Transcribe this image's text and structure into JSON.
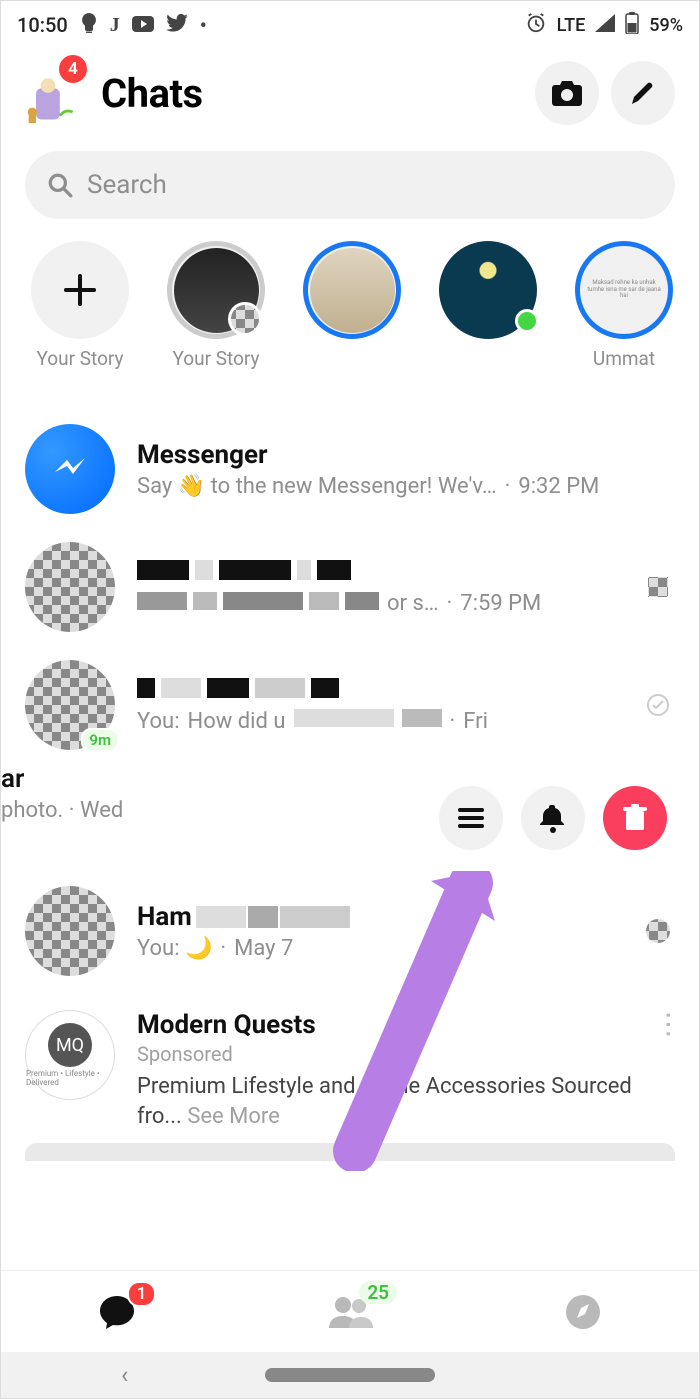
{
  "status": {
    "time": "10:50",
    "network": "LTE",
    "battery": "59%"
  },
  "header": {
    "title": "Chats",
    "badge": "4"
  },
  "search": {
    "placeholder": "Search"
  },
  "stories": [
    {
      "label": "Your Story",
      "type": "add"
    },
    {
      "label": "Your Story",
      "type": "viewed"
    },
    {
      "label": "",
      "type": "unseen"
    },
    {
      "label": "",
      "type": "online"
    },
    {
      "label": "Ummat",
      "type": "unseen"
    }
  ],
  "chats": {
    "messenger": {
      "name": "Messenger",
      "msg": "Say 👋 to the new Messenger! We'v…",
      "time": "9:32 PM"
    },
    "row1": {
      "msg_suffix": " or s…",
      "time": "7:59 PM"
    },
    "row2": {
      "you_prefix": "You:",
      "msg_prefix": "How did u",
      "time": "Fri",
      "badge": "9m"
    },
    "swiped": {
      "line1_suffix": "ar",
      "line2": "photo. · Wed"
    },
    "ham": {
      "name": "Ham",
      "you": "You: 🌙",
      "time": "May 7"
    },
    "sponsored": {
      "name": "Modern Quests",
      "tag": "Sponsored",
      "body": "Premium Lifestyle and Home Accessories Sourced fro...",
      "see_more": "See More",
      "logo": "MQ",
      "logo_sub": "Premium • Lifestyle • Delivered"
    }
  },
  "nav": {
    "chats_badge": "1",
    "people_badge": "25"
  }
}
